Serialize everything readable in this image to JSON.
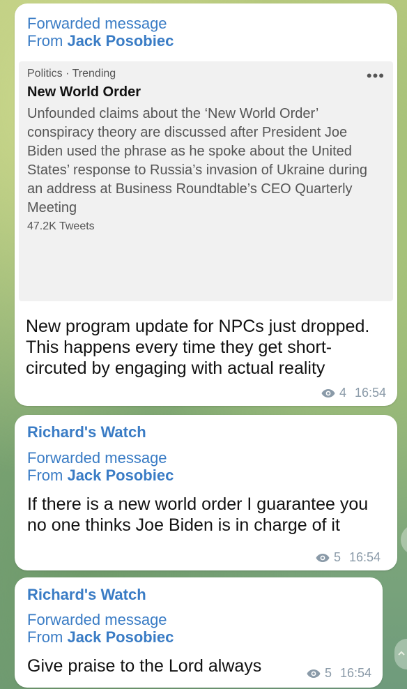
{
  "messages": [
    {
      "forwarded_label": "Forwarded message",
      "from_prefix": "From",
      "from_name": "Jack Posobiec",
      "card": {
        "category": "Politics · Trending",
        "title": "New World Order",
        "body": "Unfounded claims about the ‘New World Order’ conspiracy theory are discussed after President Joe Biden used the phrase as he spoke about the United States’ response to Russia’s invasion of Ukraine during an address at Business Roundtable’s CEO Quarterly Meeting",
        "count": "47.2K Tweets",
        "more": "•••"
      },
      "text": "New program update for NPCs just dropped. This happens every time they get short-circuted by engaging with actual reality",
      "views": "4",
      "time": "16:54"
    },
    {
      "channel": "Richard's Watch",
      "forwarded_label": "Forwarded message",
      "from_prefix": "From",
      "from_name": "Jack Posobiec",
      "text": "If there is a new world order I guarantee you no one thinks Joe Biden is in charge of it",
      "views": "5",
      "time": "16:54"
    },
    {
      "channel": "Richard's Watch",
      "forwarded_label": "Forwarded message",
      "from_prefix": "From",
      "from_name": "Jack Posobiec",
      "text": "Give praise to the Lord always",
      "views": "5",
      "time": "16:54"
    }
  ]
}
